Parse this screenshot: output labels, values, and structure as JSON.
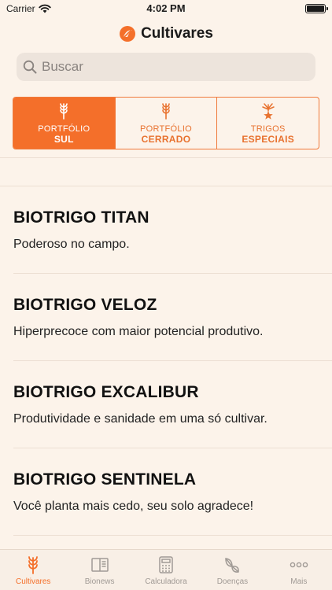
{
  "status_bar": {
    "carrier": "Carrier",
    "time": "4:02 PM"
  },
  "header": {
    "title": "Cultivares"
  },
  "search": {
    "placeholder": "Buscar"
  },
  "segments": [
    {
      "line1": "PORTFÓLIO",
      "line2": "SUL",
      "icon": "wheat-icon",
      "active": true
    },
    {
      "line1": "PORTFÓLIO",
      "line2": "CERRADO",
      "icon": "wheat-icon",
      "active": false
    },
    {
      "line1": "TRIGOS",
      "line2": "ESPECIAIS",
      "icon": "wheat-star-icon",
      "active": false
    }
  ],
  "cultivars": [
    {
      "name": "BIOTRIGO TITAN",
      "tagline": "Poderoso no campo."
    },
    {
      "name": "BIOTRIGO VELOZ",
      "tagline": "Hiperprecoce com maior potencial produtivo."
    },
    {
      "name": "BIOTRIGO EXCALIBUR",
      "tagline": "Produtividade e sanidade em uma só cultivar."
    },
    {
      "name": "BIOTRIGO SENTINELA",
      "tagline": "Você planta mais cedo, seu solo agradece!"
    }
  ],
  "tabs": [
    {
      "label": "Cultivares",
      "icon": "wheat-icon",
      "active": true
    },
    {
      "label": "Bionews",
      "icon": "book-icon",
      "active": false
    },
    {
      "label": "Calculadora",
      "icon": "calculator-icon",
      "active": false
    },
    {
      "label": "Doenças",
      "icon": "leaves-icon",
      "active": false
    },
    {
      "label": "Mais",
      "icon": "more-icon",
      "active": false
    }
  ],
  "colors": {
    "accent": "#f46f2a",
    "background": "#fcf3ea",
    "search_bg": "#ede4dc",
    "inactive": "#a09a95"
  }
}
